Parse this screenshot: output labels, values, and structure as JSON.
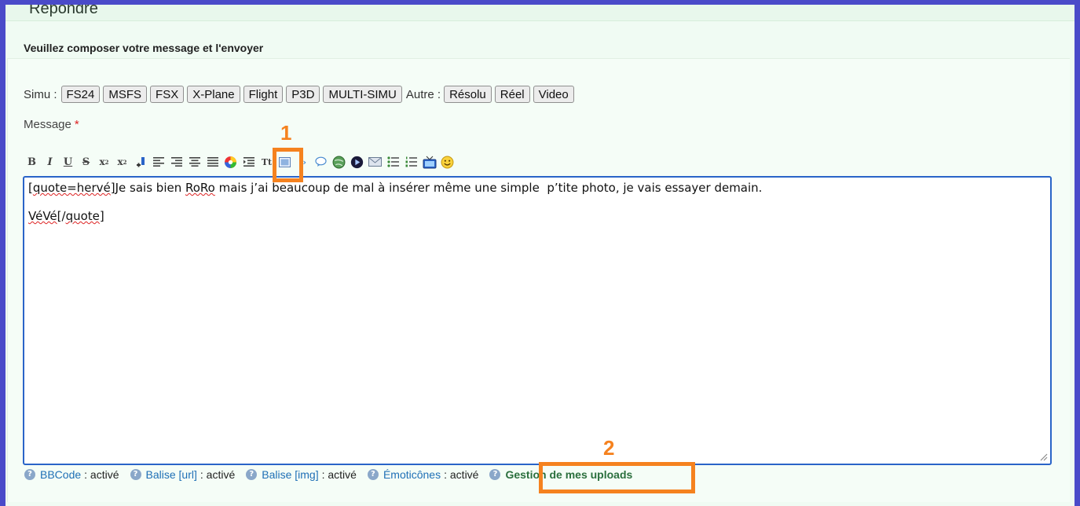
{
  "page": {
    "reply_title": "Répondre",
    "compose_heading": "Veuillez composer votre message et l'envoyer"
  },
  "tags": {
    "simu_label": "Simu :",
    "simu_buttons": [
      "FS24",
      "MSFS",
      "FSX",
      "X-Plane",
      "Flight",
      "P3D",
      "MULTI-SIMU"
    ],
    "autre_label": "Autre :",
    "autre_buttons": [
      "Résolu",
      "Réel",
      "Video"
    ]
  },
  "message": {
    "label": "Message",
    "required_mark": "*"
  },
  "toolbar": {
    "icons": [
      "bold-icon",
      "italic-icon",
      "underline-icon",
      "strikethrough-icon",
      "superscript-icon",
      "subscript-icon",
      "font-size-icon",
      "align-left-icon",
      "align-right-icon",
      "align-center-icon",
      "align-justify-icon",
      "color-icon",
      "indent-icon",
      "text-style-icon",
      "image-icon",
      "code-icon",
      "quote-icon",
      "url-icon",
      "video-icon",
      "email-icon",
      "bullet-list-icon",
      "numbered-list-icon",
      "tv-icon",
      "smiley-icon"
    ]
  },
  "editor": {
    "line1_pre": "[",
    "line1_spell1": "quote=hervé",
    "line1_mid": "]Je sais bien ",
    "line1_spell2": "RoRo",
    "line1_post": " mais j’ai beaucoup de mal à insérer même une simple  p’tite photo, je vais essayer demain.",
    "line3_spell1": "VéVé",
    "line3_mid": "[/",
    "line3_spell2": "quote",
    "line3_post": "]"
  },
  "status": {
    "bbcode_name": "BBCode",
    "bbcode_value": ": activé",
    "url_name": "Balise [url]",
    "url_value": ": activé",
    "img_name": "Balise [img]",
    "img_value": ": activé",
    "emo_name": "Émoticônes",
    "emo_value": ": activé",
    "uploads_link": "Gestion de mes uploads",
    "help_glyph": "?"
  },
  "annotations": {
    "label1": "1",
    "label2": "2",
    "color": "#f5821f"
  },
  "colors": {
    "frame": "#4a4ac9",
    "page_bg": "#f0fbf3",
    "textarea_border": "#2a64c8",
    "required": "#dd2222",
    "link_green": "#2b6f3e",
    "status_blue": "#1f6fb6"
  }
}
